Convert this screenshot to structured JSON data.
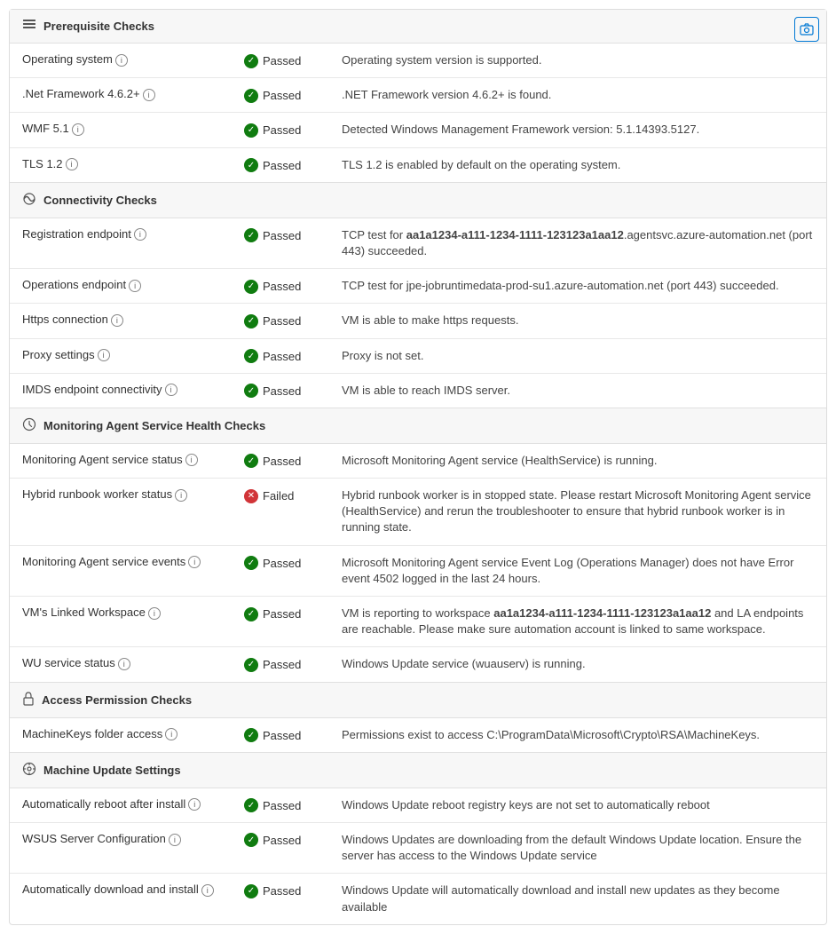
{
  "sections": [
    {
      "id": "prerequisite",
      "icon": "≡",
      "title": "Prerequisite Checks",
      "rows": [
        {
          "name": "Operating system",
          "info": true,
          "status": "Passed",
          "status_type": "passed",
          "description": "Operating system version is supported."
        },
        {
          "name": ".Net Framework 4.6.2+",
          "info": true,
          "status": "Passed",
          "status_type": "passed",
          "description": ".NET Framework version 4.6.2+ is found."
        },
        {
          "name": "WMF 5.1",
          "info": true,
          "status": "Passed",
          "status_type": "passed",
          "description": "Detected Windows Management Framework version: 5.1.14393.5127."
        },
        {
          "name": "TLS 1.2",
          "info": true,
          "status": "Passed",
          "status_type": "passed",
          "description": "TLS 1.2 is enabled by default on the operating system."
        }
      ]
    },
    {
      "id": "connectivity",
      "icon": "🔗",
      "title": "Connectivity Checks",
      "rows": [
        {
          "name": "Registration endpoint",
          "info": true,
          "status": "Passed",
          "status_type": "passed",
          "description": "TCP test for aa1a1234-a111-1234-1111-123123a1aa12.agentsvc.azure-automation.net (port 443) succeeded.",
          "description_bold_parts": [
            "aa1a1234-a111-1234-1111-123123a1aa12"
          ]
        },
        {
          "name": "Operations endpoint",
          "info": true,
          "status": "Passed",
          "status_type": "passed",
          "description": "TCP test for jpe-jobruntimedata-prod-su1.azure-automation.net (port 443) succeeded."
        },
        {
          "name": "Https connection",
          "info": true,
          "status": "Passed",
          "status_type": "passed",
          "description": "VM is able to make https requests."
        },
        {
          "name": "Proxy settings",
          "info": true,
          "status": "Passed",
          "status_type": "passed",
          "description": "Proxy is not set."
        },
        {
          "name": "IMDS endpoint connectivity",
          "info": true,
          "status": "Passed",
          "status_type": "passed",
          "description": "VM is able to reach IMDS server."
        }
      ]
    },
    {
      "id": "monitoring",
      "icon": "⚙",
      "title": "Monitoring Agent Service Health Checks",
      "rows": [
        {
          "name": "Monitoring Agent service status",
          "info": true,
          "status": "Passed",
          "status_type": "passed",
          "description": "Microsoft Monitoring Agent service (HealthService) is running."
        },
        {
          "name": "Hybrid runbook worker status",
          "info": true,
          "status": "Failed",
          "status_type": "failed",
          "description": "Hybrid runbook worker is in stopped state. Please restart Microsoft Monitoring Agent service (HealthService) and rerun the troubleshooter to ensure that hybrid runbook worker is in running state."
        },
        {
          "name": "Monitoring Agent service events",
          "info": true,
          "status": "Passed",
          "status_type": "passed",
          "description": "Microsoft Monitoring Agent service Event Log (Operations Manager) does not have Error event 4502 logged in the last 24 hours."
        },
        {
          "name": "VM's Linked Workspace",
          "info": true,
          "status": "Passed",
          "status_type": "passed",
          "description": "VM is reporting to workspace aa1a1234-a111-1234-1111-123123a1aa12 and LA endpoints are reachable. Please make sure automation account is linked to same workspace.",
          "description_bold_parts": [
            "aa1a1234-a111-1234-1111-123123a1aa12"
          ]
        },
        {
          "name": "WU service status",
          "info": true,
          "status": "Passed",
          "status_type": "passed",
          "description": "Windows Update service (wuauserv) is running."
        }
      ]
    },
    {
      "id": "access",
      "icon": "🔒",
      "title": "Access Permission Checks",
      "rows": [
        {
          "name": "MachineKeys folder access",
          "info": true,
          "status": "Passed",
          "status_type": "passed",
          "description": "Permissions exist to access C:\\ProgramData\\Microsoft\\Crypto\\RSA\\MachineKeys."
        }
      ]
    },
    {
      "id": "machine-update",
      "icon": "⚙",
      "title": "Machine Update Settings",
      "rows": [
        {
          "name": "Automatically reboot after install",
          "info": true,
          "status": "Passed",
          "status_type": "passed",
          "description": "Windows Update reboot registry keys are not set to automatically reboot"
        },
        {
          "name": "WSUS Server Configuration",
          "info": true,
          "status": "Passed",
          "status_type": "passed",
          "description": "Windows Updates are downloading from the default Windows Update location. Ensure the server has access to the Windows Update service"
        },
        {
          "name": "Automatically download and install",
          "info": true,
          "status": "Passed",
          "status_type": "passed",
          "description": "Windows Update will automatically download and install new updates as they become available"
        }
      ]
    }
  ],
  "camera_icon": "📷",
  "status_labels": {
    "passed": "Passed",
    "failed": "Failed"
  },
  "info_tooltip": "i"
}
